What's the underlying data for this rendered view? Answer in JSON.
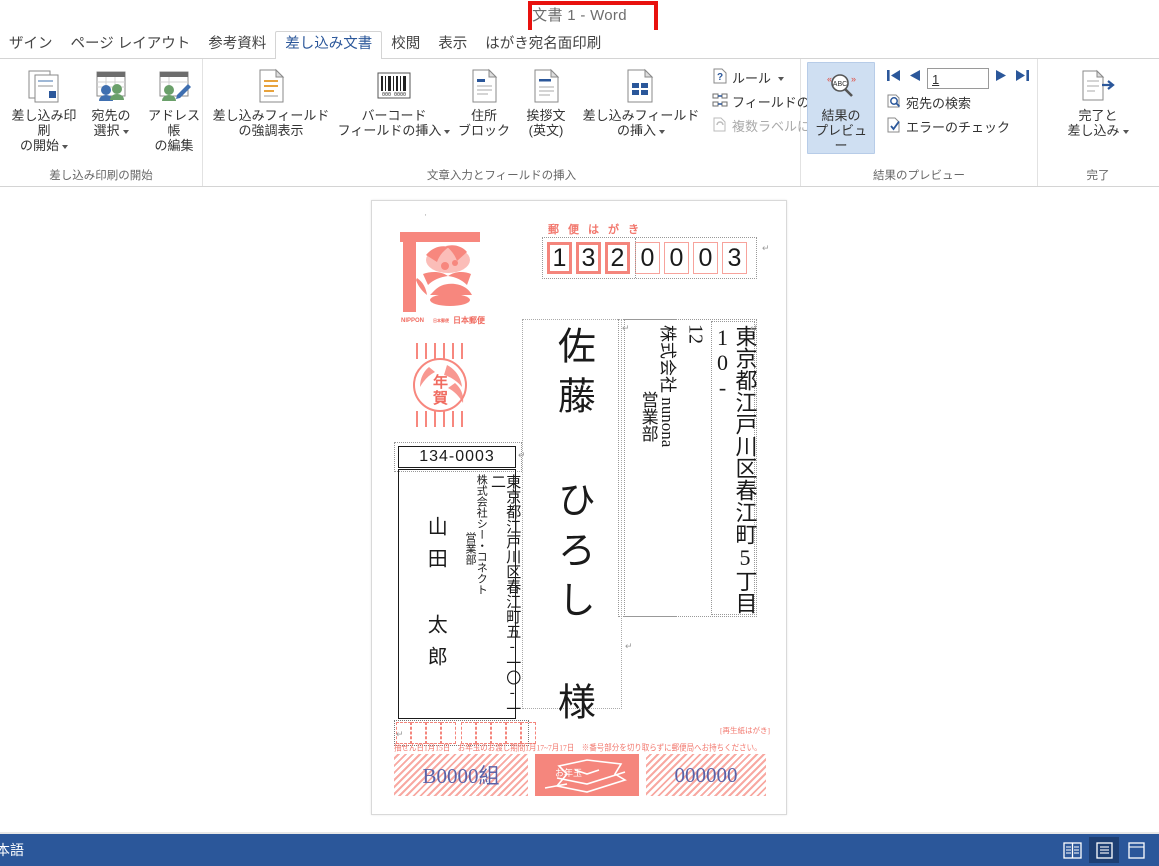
{
  "window": {
    "title": "文書 1 - Word",
    "highlight_color": "#e8110e"
  },
  "tabs": [
    {
      "label": "ザイン",
      "active": false
    },
    {
      "label": "ページ レイアウト",
      "active": false
    },
    {
      "label": "参考資料",
      "active": false
    },
    {
      "label": "差し込み文書",
      "active": true
    },
    {
      "label": "校閲",
      "active": false
    },
    {
      "label": "表示",
      "active": false
    },
    {
      "label": "はがき宛名面印刷",
      "active": false
    }
  ],
  "ribbon": {
    "accent_color": "#2b579a",
    "groups": [
      {
        "name": "mail-merge-start",
        "label": "差し込み印刷の開始",
        "buttons": [
          {
            "name": "start-mail-merge",
            "label": "差し込み印刷\nの開始",
            "icon": "document-merge-icon",
            "dropdown": true
          },
          {
            "name": "select-recipients",
            "label": "宛先の\n選択",
            "icon": "recipients-icon",
            "dropdown": true
          },
          {
            "name": "edit-recipient-list",
            "label": "アドレス帳\nの編集",
            "icon": "edit-address-icon",
            "dropdown": false
          }
        ]
      },
      {
        "name": "write-insert-fields",
        "label": "文章入力とフィールドの挿入",
        "buttons": [
          {
            "name": "highlight-merge-fields",
            "label": "差し込みフィールド\nの強調表示",
            "icon": "highlight-field-icon",
            "dropdown": false
          },
          {
            "name": "insert-barcode-field",
            "label": "バーコード\nフィールドの挿入",
            "icon": "barcode-icon",
            "dropdown": true
          },
          {
            "name": "address-block",
            "label": "住所\nブロック",
            "icon": "address-block-icon",
            "dropdown": false
          },
          {
            "name": "greeting-line",
            "label": "挨拶文\n(英文)",
            "icon": "greeting-line-icon",
            "dropdown": false
          },
          {
            "name": "insert-merge-field",
            "label": "差し込みフィールド\nの挿入",
            "icon": "insert-field-icon",
            "dropdown": true
          }
        ],
        "small_buttons": [
          {
            "name": "rules",
            "label": "ルール",
            "icon": "rules-icon",
            "dropdown": true,
            "disabled": false
          },
          {
            "name": "match-fields",
            "label": "フィールドの対応",
            "icon": "match-fields-icon",
            "dropdown": false,
            "disabled": false
          },
          {
            "name": "update-labels",
            "label": "複数ラベルに反映",
            "icon": "update-labels-icon",
            "dropdown": false,
            "disabled": true
          }
        ]
      },
      {
        "name": "preview-results",
        "label": "結果のプレビュー",
        "buttons": [
          {
            "name": "preview-results",
            "label": "結果の\nプレビュー",
            "icon": "preview-abc-icon",
            "selected": true
          }
        ],
        "record_nav": {
          "first": "first-record-icon",
          "prev": "previous-record-icon",
          "value": "1",
          "next": "next-record-icon",
          "last": "last-record-icon"
        },
        "small_buttons": [
          {
            "name": "find-recipient",
            "label": "宛先の検索",
            "icon": "find-recipient-icon",
            "disabled": false
          },
          {
            "name": "check-errors",
            "label": "エラーのチェック",
            "icon": "check-errors-icon",
            "disabled": false
          }
        ]
      },
      {
        "name": "finish",
        "label": "完了",
        "buttons": [
          {
            "name": "finish-and-merge",
            "label": "完了と\n差し込み",
            "icon": "finish-merge-icon",
            "dropdown": true
          }
        ]
      }
    ]
  },
  "document": {
    "postcard": {
      "header_text": "郵便はがき",
      "postal_code_digits": [
        "1",
        "3",
        "2",
        "0",
        "0",
        "0",
        "3"
      ],
      "recipient": {
        "address_line1": "東京都江戸川区春江町5丁目10-",
        "address_line2": "12",
        "company": "株式会社 nunona",
        "department": "営業部",
        "name": "佐藤 ひろし",
        "honorific": "様"
      },
      "sender": {
        "postal_code": "134-0003",
        "address": "東京都江戸川区春江町五-一〇-一二",
        "company": "株式会社シー・コネクト",
        "department": "営業部",
        "name": "山田 太郎"
      },
      "stamp": {
        "country_label": "NIPPON",
        "post_label": "日本郵便",
        "postmark_text": "年賀"
      },
      "lottery": {
        "recycle_label": "[再生紙はがき]",
        "note": "抽せん日1月15日　お年玉のお渡し期間1月17~7月17日　※番号部分を切り取らずに郵便局へお持ちください。",
        "group_number": "B0000組",
        "badge_label": "お年玉",
        "serial_number": "000000"
      }
    }
  },
  "statusbar": {
    "language": "本語",
    "background_color": "#2b579a",
    "view_buttons": [
      {
        "name": "read-mode-icon",
        "active": false
      },
      {
        "name": "print-layout-icon",
        "active": true
      },
      {
        "name": "web-layout-icon",
        "active": false
      }
    ]
  }
}
